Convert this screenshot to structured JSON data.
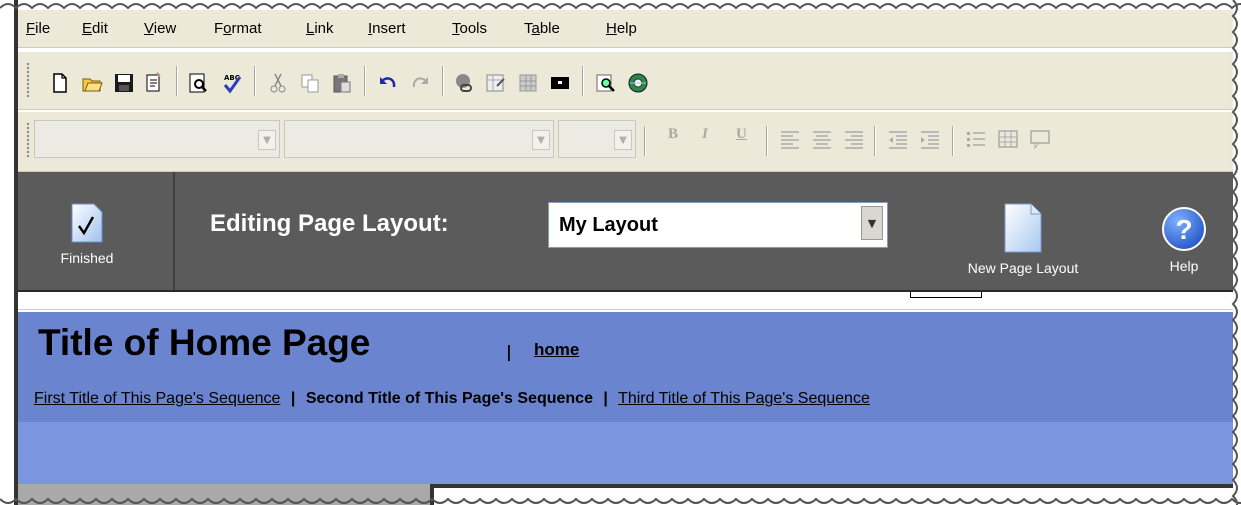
{
  "menubar": {
    "items": [
      {
        "underline": "F",
        "rest": "ile"
      },
      {
        "underline": "E",
        "rest": "dit"
      },
      {
        "underline": "V",
        "rest": "iew"
      },
      {
        "pre": "F",
        "underline": "o",
        "rest": "rmat"
      },
      {
        "underline": "L",
        "rest": "ink"
      },
      {
        "underline": "I",
        "rest": "nsert"
      },
      {
        "underline": "T",
        "rest": "ools"
      },
      {
        "pre": "T",
        "underline": "a",
        "rest": "ble"
      },
      {
        "underline": "H",
        "rest": "elp"
      }
    ]
  },
  "toolbar1": {
    "icons": [
      "new-document-icon",
      "open-folder-icon",
      "save-icon",
      "paste-special-icon",
      "print-preview-icon",
      "spell-check-icon",
      "cut-icon",
      "copy-icon",
      "paste-icon",
      "undo-icon",
      "redo-icon",
      "insert-link-icon",
      "insert-image-icon",
      "insert-table-image-icon",
      "insert-object-icon",
      "preview-icon",
      "publish-icon"
    ]
  },
  "toolbar2": {
    "bold": "B",
    "italic": "I",
    "underline": "U"
  },
  "editbar": {
    "finished_label": "Finished",
    "caption": "Editing Page Layout:",
    "layout_value": "My Layout",
    "new_layout_label": "New Page Layout",
    "help_label": "Help",
    "help_glyph": "?"
  },
  "site": {
    "title": "Title of Home Page",
    "pipe": "|",
    "home_link": "home",
    "seq_sep": "|",
    "sequence": [
      {
        "label": "First Title of This Page's Sequence",
        "current": false
      },
      {
        "label": "Second Title of This Page's Sequence",
        "current": true
      },
      {
        "label": "Third Title of This Page's Sequence",
        "current": false
      }
    ]
  },
  "colors": {
    "header_blue": "#6b84cf",
    "subband_blue": "#7b95de",
    "editbar_gray": "#5b5b5b",
    "toolbar_beige": "#ece9d8"
  }
}
